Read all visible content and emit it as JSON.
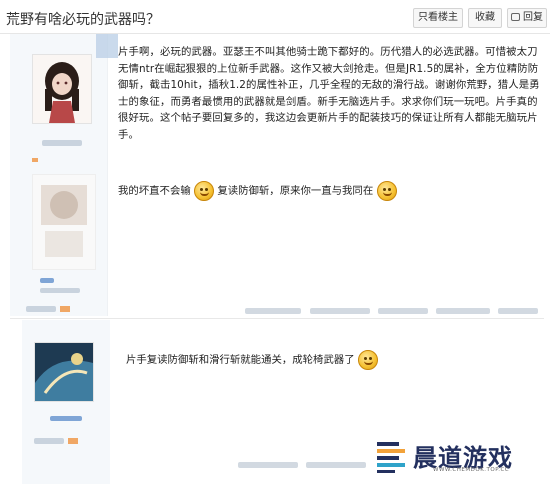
{
  "header": {
    "title": "荒野有啥必玩的武器吗？",
    "buttons": {
      "only_op": "只看楼主",
      "favorite": "收藏",
      "reply": "回复"
    }
  },
  "post1": {
    "body": "片手啊，必玩的武器。亚瑟王不叫其他骑士跪下都好的。历代猎人的必选武器。可惜被太刀无情ntr在崛起狠狠的上位新手武器。这作又被大剑抢走。但是JR1.5的属补，全方位精防防御斩，截击10hit，插秋1.2的属性补正，几乎全程的无敌的滑行战。谢谢你荒野，猎人是勇士的象征，而勇者最惯用的武器就是剑盾。新手无脑选片手。求求你们玩一玩吧。片手真的很好玩。这个帖子要回复多的，我这边会更新片手的配装技巧的保证让所有人都能无脑玩片手。",
    "signature_part1": "我的坏直不会输",
    "signature_part2": "复读防御斩，原来你一直与我同在",
    "emoji": "smile-emoji"
  },
  "post2": {
    "body": "片手复读防御斩和滑行斩就能通关，成轮椅武器了"
  },
  "watermark": {
    "title": "晨道游戏",
    "subtitle": "WWW.CHEMDOK.TOP.CC"
  },
  "colors": {
    "sidebar_bg": "#f5f8fb",
    "watermark_title": "#23305f",
    "emoji": "#f5c030"
  }
}
